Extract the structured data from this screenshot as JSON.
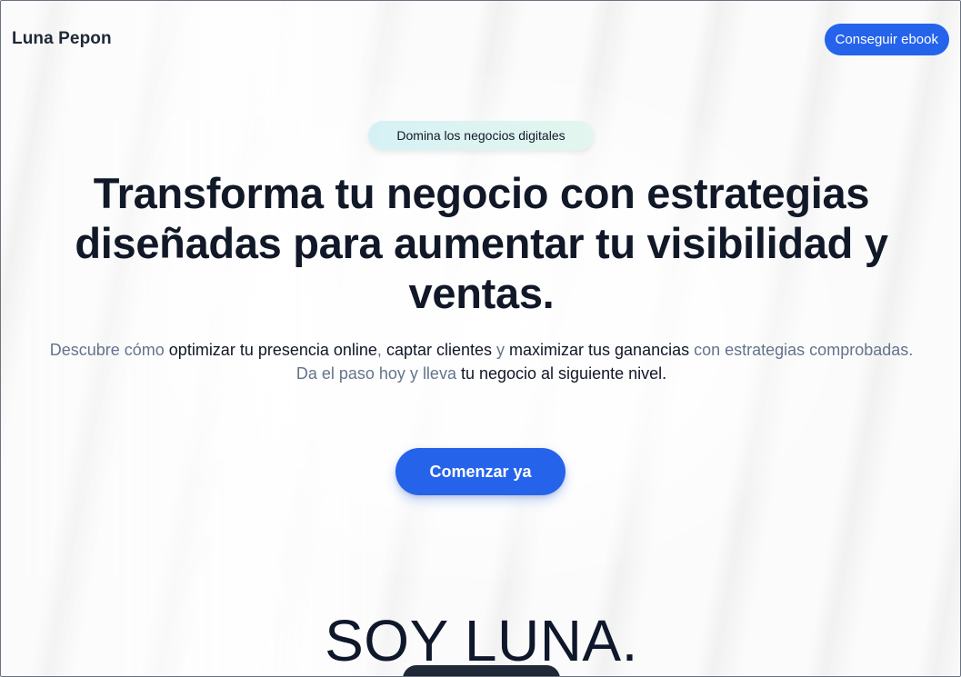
{
  "header": {
    "brand": "Luna Pepon",
    "cta_label": "Conseguir ebook"
  },
  "hero": {
    "badge": "Domina los negocios digitales",
    "headline_line1": "Transforma tu negocio con estrategias",
    "headline_line2": "diseñadas para aumentar tu visibilidad y",
    "headline_line3": "ventas.",
    "sub": {
      "p1": "Descubre cómo ",
      "p2": "optimizar tu presencia online",
      "p3": ", ",
      "p4": "captar clientes",
      "p5": " y ",
      "p6": "maximizar tus ganancias",
      "p7": " con estrategias comprobadas.",
      "p8": "Da el paso hoy y lleva ",
      "p9": "tu negocio al siguiente nivel."
    },
    "cta_label": "Comenzar ya"
  },
  "about": {
    "title": "SOY LUNA."
  },
  "colors": {
    "accent": "#2563eb",
    "text_dark": "#111827",
    "text_muted": "#64748b"
  }
}
